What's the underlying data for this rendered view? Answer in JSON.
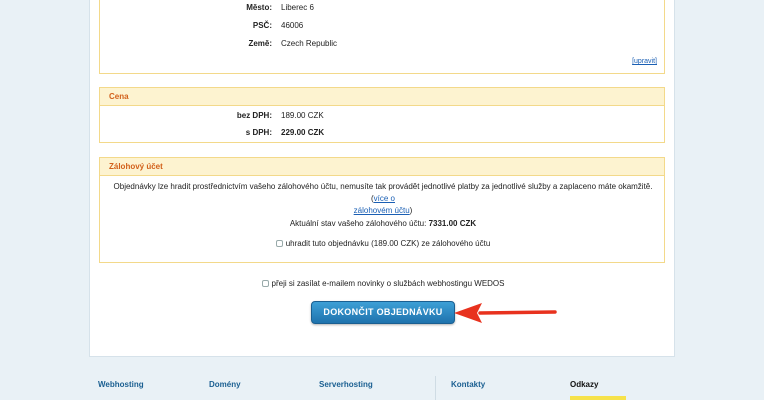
{
  "address": {
    "city_label": "Město:",
    "city_value": "Liberec 6",
    "zip_label": "PSČ:",
    "zip_value": "46006",
    "country_label": "Země:",
    "country_value": "Czech Republic",
    "edit_link": "[upravit]"
  },
  "price": {
    "title": "Cena",
    "no_vat_label": "bez DPH:",
    "no_vat_value": "189.00 CZK",
    "vat_label": "s DPH:",
    "vat_value": "229.00 CZK"
  },
  "deposit": {
    "title": "Zálohový účet",
    "description": "Objednávky lze hradit prostřednictvím vašeho zálohového účtu, nemusíte tak provádět jednotlivé platby za jednotlivé služby a zaplaceno máte okamžitě.",
    "more_link_1": "více o",
    "more_link_2": "zálohovém účtu",
    "balance_label": "Aktuální stav vašeho zálohového účtu:",
    "balance_value": "7331.00 CZK",
    "pay_checkbox_label": "uhradit tuto objednávku (189.00 CZK) ze zálohového účtu"
  },
  "newsletter_label": "přeji si zasílat e-mailem novinky o službách webhostingu WEDOS",
  "submit_label": "DOKONČIT OBJEDNÁVKU",
  "footer": {
    "links": [
      "Webhosting",
      "Domény",
      "Serverhosting",
      "Kontakty",
      "Odkazy"
    ]
  },
  "colors": {
    "accent_orange": "#d2601a",
    "box_border": "#f3d98a",
    "button_blue": "#2a86c4",
    "arrow_red": "#e8321e"
  }
}
